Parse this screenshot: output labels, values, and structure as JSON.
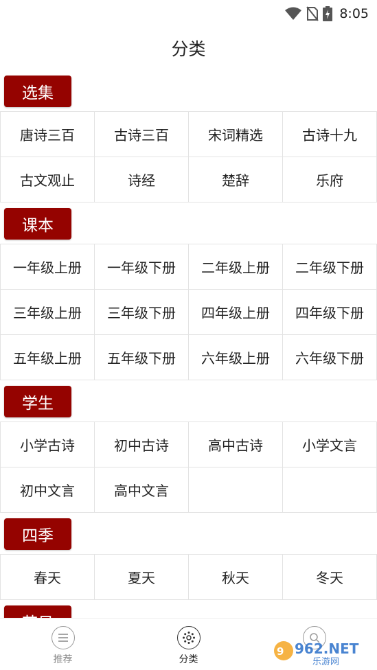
{
  "status_bar": {
    "time": "8:05"
  },
  "page_title": "分类",
  "sections": [
    {
      "title": "选集",
      "items": [
        "唐诗三百",
        "古诗三百",
        "宋词精选",
        "古诗十九",
        "古文观止",
        "诗经",
        "楚辞",
        "乐府"
      ]
    },
    {
      "title": "课本",
      "items": [
        "一年级上册",
        "一年级下册",
        "二年级上册",
        "二年级下册",
        "三年级上册",
        "三年级下册",
        "四年级上册",
        "四年级下册",
        "五年级上册",
        "五年级下册",
        "六年级上册",
        "六年级下册"
      ]
    },
    {
      "title": "学生",
      "items": [
        "小学古诗",
        "初中古诗",
        "高中古诗",
        "小学文言",
        "初中文言",
        "高中文言",
        "",
        ""
      ]
    },
    {
      "title": "四季",
      "items": [
        "春天",
        "夏天",
        "秋天",
        "冬天"
      ]
    },
    {
      "title": "节日",
      "items": []
    }
  ],
  "bottom_nav": [
    {
      "label": "推荐",
      "icon": "list-icon",
      "active": false
    },
    {
      "label": "分类",
      "icon": "category-icon",
      "active": true
    },
    {
      "label": "",
      "icon": "search-icon",
      "active": false
    }
  ],
  "watermark": {
    "text": "962.NET",
    "subtext": "乐游网"
  },
  "colors": {
    "accent": "#950300"
  }
}
